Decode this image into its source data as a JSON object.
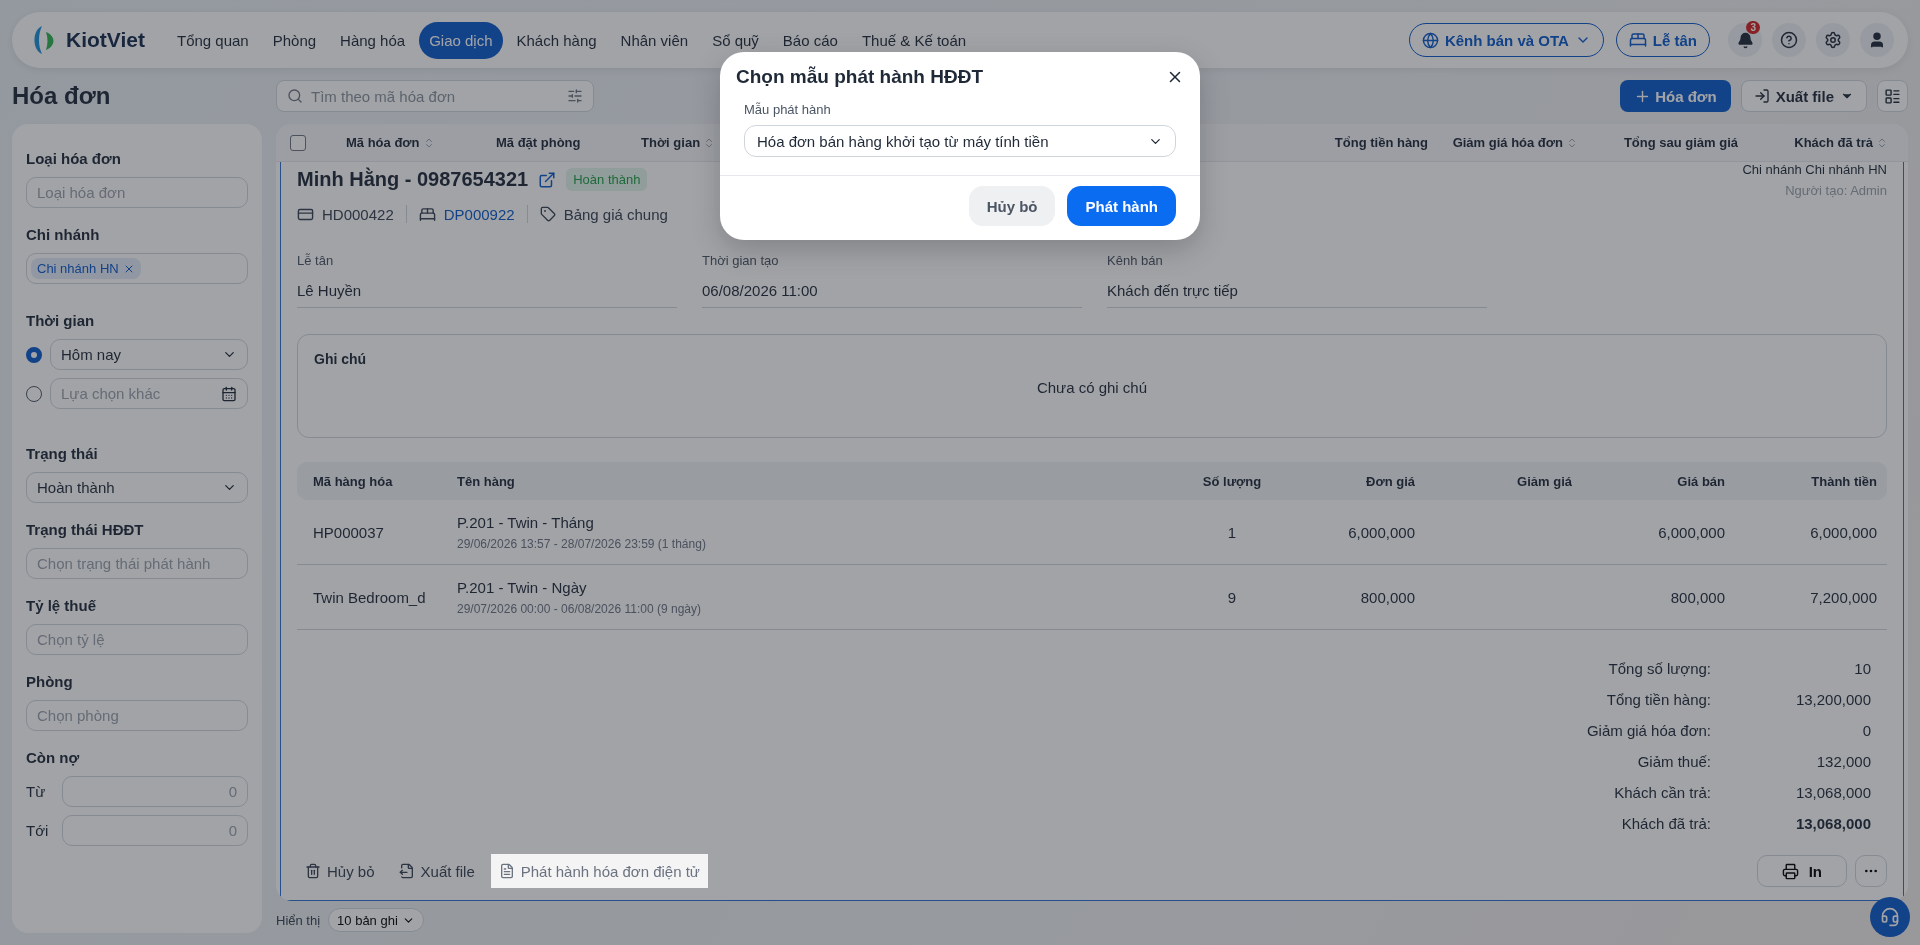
{
  "nav": {
    "logo": "KiotViet",
    "items": [
      {
        "label": "Tổng quan",
        "selected": false
      },
      {
        "label": "Phòng",
        "selected": false
      },
      {
        "label": "Hàng hóa",
        "selected": false
      },
      {
        "label": "Giao dịch",
        "selected": true
      },
      {
        "label": "Khách hàng",
        "selected": false
      },
      {
        "label": "Nhân viên",
        "selected": false
      },
      {
        "label": "Sổ quỹ",
        "selected": false
      },
      {
        "label": "Báo cáo",
        "selected": false
      },
      {
        "label": "Thuế & Kế toán",
        "selected": false
      }
    ],
    "channel_button": "Kênh bán và OTA",
    "reception_button": "Lễ tân",
    "notification_count": "3"
  },
  "page": {
    "title": "Hóa đơn",
    "search_placeholder": "Tìm theo mã hóa đơn",
    "new_button": "Hóa đơn",
    "export_button": "Xuất file"
  },
  "filters": [
    {
      "kind": "input",
      "label": "Loại hóa đơn",
      "placeholder": "Loại hóa đơn"
    },
    {
      "kind": "tags",
      "label": "Chi nhánh",
      "tags": [
        "Chi nhánh HN"
      ]
    },
    {
      "kind": "radio",
      "label": "Thời gian",
      "options": [
        {
          "kind": "select",
          "value": "Hôm nay",
          "selected": true
        },
        {
          "kind": "date",
          "placeholder": "Lựa chọn khác",
          "selected": false
        }
      ]
    },
    {
      "kind": "select",
      "label": "Trạng thái",
      "value": "Hoàn thành"
    },
    {
      "kind": "input",
      "label": "Trạng thái HĐĐT",
      "placeholder": "Chọn trạng thái phát hành"
    },
    {
      "kind": "input",
      "label": "Tỷ lệ thuế",
      "placeholder": "Chọn tỷ lệ"
    },
    {
      "kind": "input",
      "label": "Phòng",
      "placeholder": "Chọn phòng"
    },
    {
      "kind": "range",
      "label": "Còn nợ",
      "rows": [
        {
          "label": "Từ",
          "placeholder": "0"
        },
        {
          "label": "Tới",
          "placeholder": "0"
        }
      ]
    }
  ],
  "table": {
    "select_all_checked": false,
    "columns": [
      {
        "label": "Mã hóa đơn",
        "sortable": true
      },
      {
        "label": "Mã đặt phòng",
        "sortable": false
      },
      {
        "label": "Thời gian",
        "sortable": true
      },
      {
        "label": "Tổng tiền hàng",
        "sortable": false
      },
      {
        "label": "Giảm giá hóa đơn",
        "sortable": true
      },
      {
        "label": "Tổng sau giảm giá",
        "sortable": false
      },
      {
        "label": "Khách đã trả",
        "sortable": true
      }
    ]
  },
  "detail": {
    "customer": "Minh Hằng - 0987654321",
    "status": "Hoàn thành",
    "branch": "Chi nhánh Chi nhánh HN",
    "creator": "Người tạo: Admin",
    "invoice_code": "HD000422",
    "booking_code": "DP000922",
    "price_list": "Bảng giá chung",
    "fields": [
      {
        "label": "Lễ tân",
        "value": "Lê Huyền"
      },
      {
        "label": "Thời gian tạo",
        "value": "06/08/2026 11:00"
      },
      {
        "label": "Kênh bán",
        "value": "Khách đến trực tiếp"
      }
    ],
    "note": {
      "label": "Ghi chú",
      "text": "Chưa có ghi chú"
    },
    "item_columns": [
      "Mã hàng hóa",
      "Tên hàng",
      "Số lượng",
      "Đơn giá",
      "Giảm giá",
      "Giá bán",
      "Thành tiền"
    ],
    "items": [
      {
        "code": "HP000037",
        "name": "P.201 - Twin - Tháng",
        "period": "29/06/2026 13:57 - 28/07/2026 23:59 (1 tháng)",
        "quantity": "1",
        "unit_price": "6,000,000",
        "sale_price": "6,000,000",
        "total": "6,000,000"
      },
      {
        "code": "Twin Bedroom_d",
        "name": "P.201 - Twin - Ngày",
        "period": "29/07/2026 00:00 - 06/08/2026 11:00 (9 ngày)",
        "quantity": "9",
        "unit_price": "800,000",
        "sale_price": "800,000",
        "total": "7,200,000"
      }
    ],
    "totals": [
      {
        "label": "Tổng số lượng:",
        "value": "10",
        "bold": false
      },
      {
        "label": "Tổng tiền hàng:",
        "value": "13,200,000",
        "bold": false
      },
      {
        "label": "Giảm giá hóa đơn:",
        "value": "0",
        "bold": false
      },
      {
        "label": "Giảm thuế:",
        "value": "132,000",
        "bold": false
      },
      {
        "label": "Khách cần trả:",
        "value": "13,068,000",
        "bold": false
      },
      {
        "label": "Khách đã trả:",
        "value": "13,068,000",
        "bold": true
      }
    ],
    "actions": [
      {
        "kind": "delete",
        "label": "Hủy bỏ",
        "highlighted": false
      },
      {
        "kind": "export",
        "label": "Xuất file",
        "highlighted": false
      },
      {
        "kind": "einvoice",
        "label": "Phát hành hóa đơn điện tử",
        "highlighted": true
      }
    ],
    "print_button": "In"
  },
  "footer": {
    "label": "Hiển thị",
    "page_size": "10 bản ghi"
  },
  "modal": {
    "title": "Chọn mẫu phát hành HĐĐT",
    "field_label": "Mẫu phát hành",
    "field_value": "Hóa đơn bán hàng khởi tạo từ máy tính tiền",
    "cancel_button": "Hủy bỏ",
    "confirm_button": "Phát hành"
  }
}
